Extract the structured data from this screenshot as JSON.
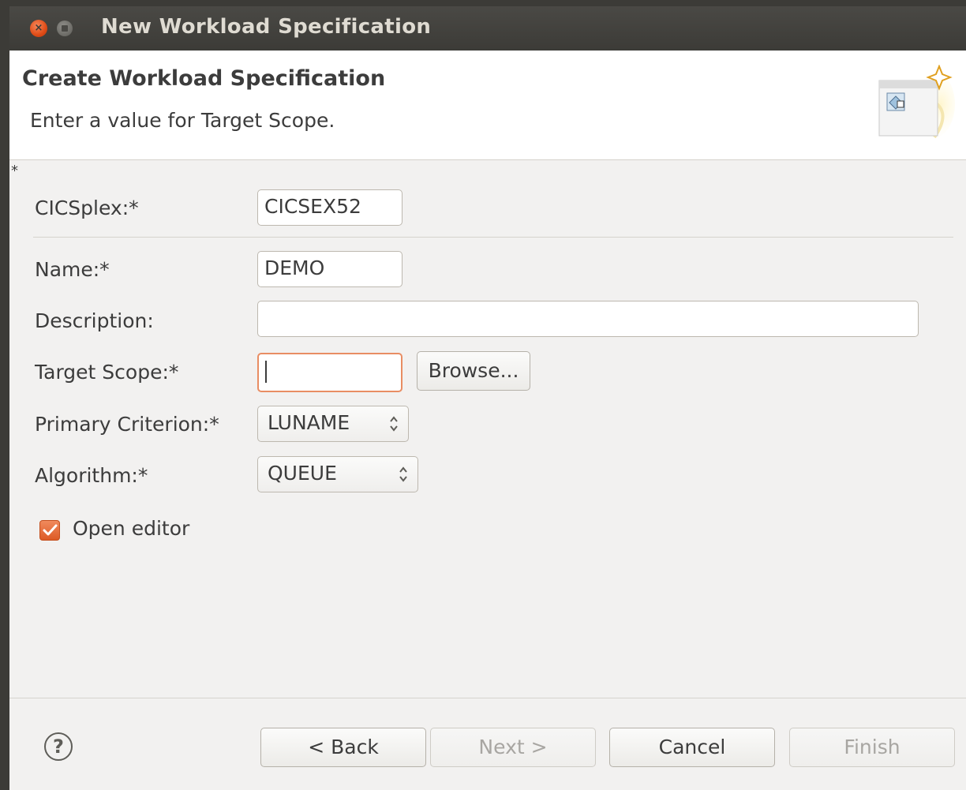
{
  "window": {
    "title": "New Workload Specification",
    "close_glyph": "×"
  },
  "header": {
    "title": "Create Workload Specification",
    "message": "Enter a value for Target Scope."
  },
  "required_marker": "*",
  "form": {
    "cicsplex": {
      "label": "CICSplex:*",
      "value": "CICSEX52"
    },
    "name": {
      "label": "Name:*",
      "value": "DEMO"
    },
    "description": {
      "label": "Description:",
      "value": ""
    },
    "target_scope": {
      "label": "Target Scope:*",
      "value": "",
      "browse_label": "Browse..."
    },
    "primary_criterion": {
      "label": "Primary Criterion:*",
      "value": "LUNAME"
    },
    "algorithm": {
      "label": "Algorithm:*",
      "value": "QUEUE"
    },
    "open_editor": {
      "label": "Open editor",
      "checked": true
    }
  },
  "footer": {
    "help_glyph": "?",
    "back_label": "< Back",
    "next_label": "Next >",
    "cancel_label": "Cancel",
    "finish_label": "Finish"
  },
  "colors": {
    "accent": "#dd5a25",
    "focus_border": "#e98d63",
    "titlebar": "#3c3b37"
  },
  "icons": [
    "close-icon",
    "minimize-icon",
    "wizard-banner-icon",
    "checkmark-icon",
    "updown-arrows-icon",
    "help-icon"
  ]
}
